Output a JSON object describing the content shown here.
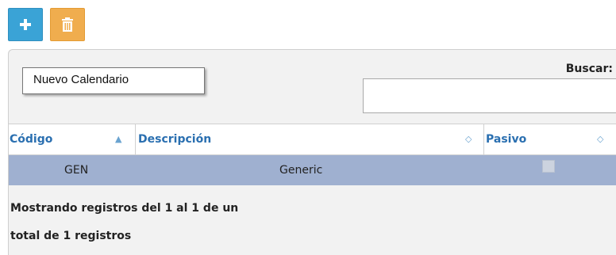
{
  "toolbar": {
    "add_icon": "plus-icon",
    "delete_icon": "trash-icon",
    "add_color": "#3aa3d6",
    "delete_color": "#f0ad4e"
  },
  "tooltip": {
    "text": "Nuevo Calendario"
  },
  "search": {
    "label": "Buscar:",
    "value": ""
  },
  "table": {
    "columns": [
      {
        "label": "Código",
        "sort": "ascending"
      },
      {
        "label": "Descripción",
        "sort": "sortable"
      },
      {
        "label": "Pasivo",
        "sort": "sortable"
      }
    ],
    "rows": [
      {
        "codigo": "GEN",
        "descripcion": "Generic",
        "pasivo": false
      }
    ],
    "selected_row_color": "#9fb0d0"
  },
  "info": {
    "line1": "Mostrando registros del 1 al 1 de un",
    "line2": "total de 1 registros"
  }
}
